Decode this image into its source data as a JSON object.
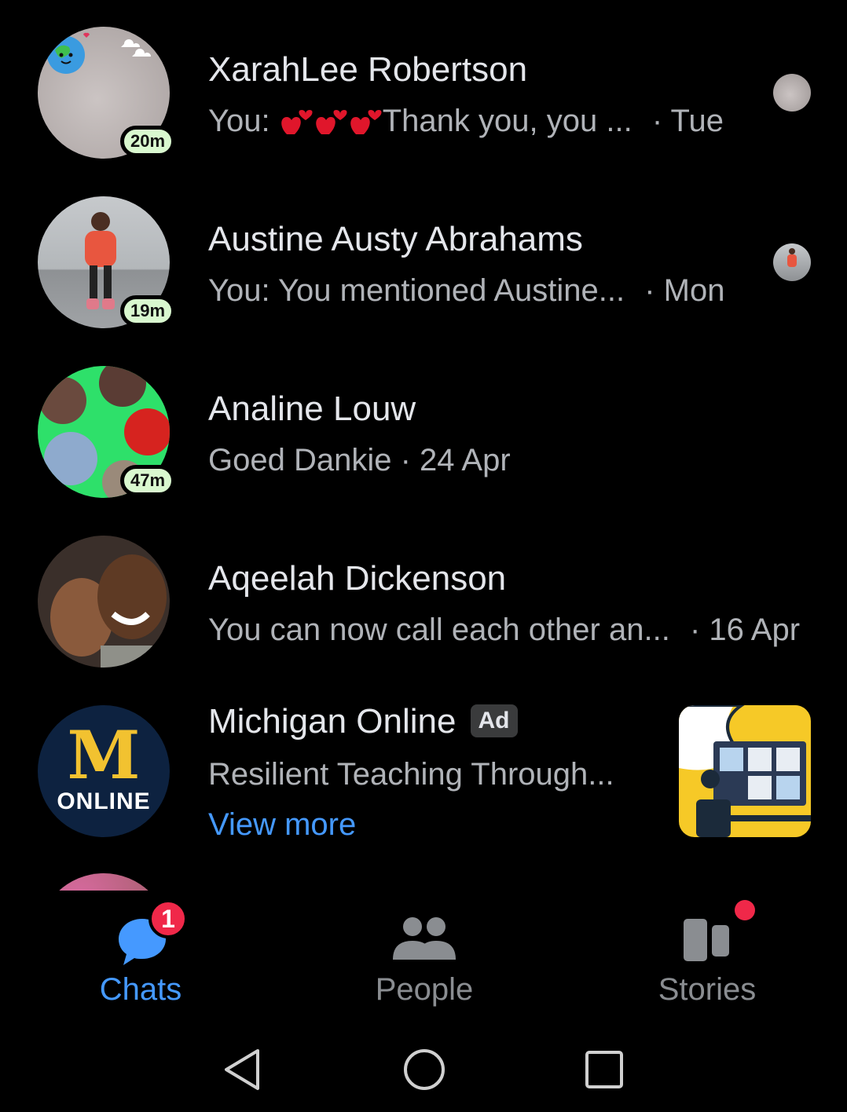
{
  "chats": [
    {
      "name": "XarahLee Robertson",
      "preview_prefix": "You:",
      "preview_text": "Thank you, you ...",
      "date": "· Tue",
      "badge": "20m",
      "emoji": "heart-emoji"
    },
    {
      "name": "Austine Austy Abrahams",
      "preview_text": "You: You mentioned Austine...",
      "date": "· Mon",
      "badge": "19m"
    },
    {
      "name": "Analine Louw",
      "preview_text": "Goed Dankie · 24 Apr",
      "badge": "47m"
    },
    {
      "name": "Aqeelah Dickenson",
      "preview_text": "You can now call each other an...",
      "date": "· 16 Apr"
    }
  ],
  "ad": {
    "name": "Michigan Online",
    "badge": "Ad",
    "preview": "Resilient Teaching Through...",
    "cta": "View more",
    "logo_letter": "M",
    "logo_text": "ONLINE"
  },
  "tabs": [
    {
      "label": "Chats",
      "active": true,
      "badge": "1",
      "icon": "chat-bubble-icon"
    },
    {
      "label": "People",
      "active": false,
      "icon": "people-icon"
    },
    {
      "label": "Stories",
      "active": false,
      "icon": "stories-icon",
      "dot": true
    }
  ],
  "colors": {
    "accent": "#4599ff",
    "badge_red": "#f02849",
    "time_badge": "#d9f8cf",
    "michigan_navy": "#0d2240",
    "michigan_maize": "#f2c230"
  }
}
